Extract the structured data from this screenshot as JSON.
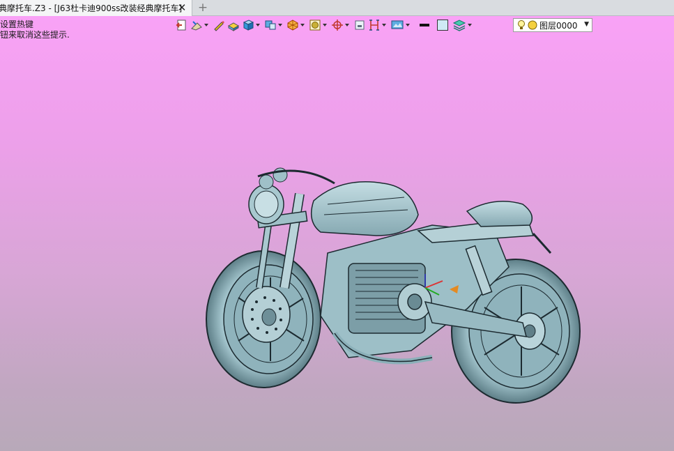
{
  "tabs": [
    {
      "label": "典摩托车.Z3 - [J63杜卡迪900ss改装经典摩托车]",
      "active": true,
      "close_icon": "close-icon"
    }
  ],
  "new_tab_icon": "plus-icon",
  "viewport": {
    "hint_lines": [
      "设置热键",
      "钮来取消这些提示."
    ],
    "background_top": "#f9a2f6",
    "background_bottom": "#b8a9b9"
  },
  "toolbar": {
    "items": [
      {
        "name": "exit-icon",
        "has_dropdown": false
      },
      {
        "name": "sketch-icon",
        "has_dropdown": true
      },
      {
        "name": "pen-icon",
        "has_dropdown": false
      },
      {
        "name": "shaded-icon",
        "has_dropdown": false
      },
      {
        "name": "cube-icon",
        "has_dropdown": true
      },
      {
        "name": "view-cube-icon",
        "has_dropdown": true
      },
      {
        "name": "render-icon",
        "has_dropdown": true
      },
      {
        "name": "zoom-fit-icon",
        "has_dropdown": true
      },
      {
        "name": "origin-icon",
        "has_dropdown": true
      },
      {
        "name": "frame-icon",
        "has_dropdown": false
      },
      {
        "name": "section-icon",
        "has_dropdown": true
      },
      {
        "name": "display-icon",
        "has_dropdown": true
      },
      {
        "name": "line-color-icon",
        "has_dropdown": false
      },
      {
        "name": "fill-color-icon",
        "has_dropdown": false
      },
      {
        "name": "layers-icon",
        "has_dropdown": true
      }
    ],
    "layer_selector": {
      "value": "图层0000",
      "icons": [
        "bulb-icon",
        "layer-dot-icon"
      ]
    }
  },
  "model": {
    "description_color": "#a6c8d0",
    "edge_color": "#1c2a30"
  }
}
